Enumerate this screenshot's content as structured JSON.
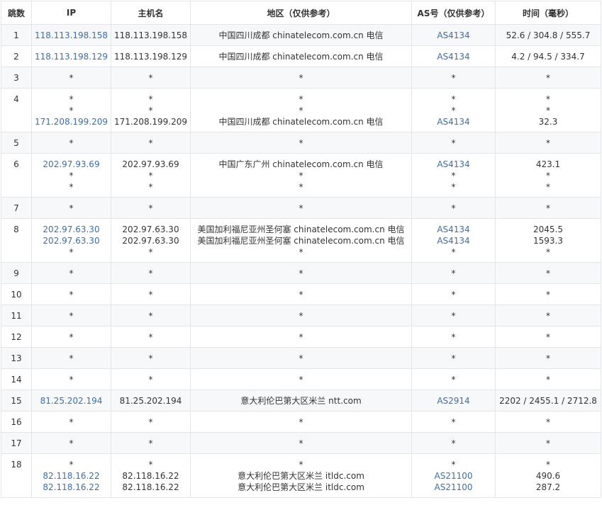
{
  "columns": {
    "hop": "跳数",
    "ip": "IP",
    "host": "主机名",
    "region": "地区（仅供参考）",
    "as": "AS号（仅供参考）",
    "time": "时间（毫秒）"
  },
  "colors": {
    "link": "#3d6ea5",
    "text": "#333333",
    "border": "#e3e5e8",
    "stripe": "#f7f8fa"
  },
  "rows": [
    {
      "hop": "1",
      "entries": [
        {
          "ip": "118.113.198.158",
          "host": "118.113.198.158",
          "region": "中国四川成都 chinatelecom.com.cn 电信",
          "as": "AS4134",
          "time": "52.6 / 304.8 / 555.7"
        }
      ]
    },
    {
      "hop": "2",
      "entries": [
        {
          "ip": "118.113.198.129",
          "host": "118.113.198.129",
          "region": "中国四川成都 chinatelecom.com.cn 电信",
          "as": "AS4134",
          "time": "4.2 / 94.5 / 334.7"
        }
      ]
    },
    {
      "hop": "3",
      "entries": [
        {
          "ip": "*",
          "host": "*",
          "region": "*",
          "as": "*",
          "time": "*"
        }
      ]
    },
    {
      "hop": "4",
      "entries": [
        {
          "ip": "*",
          "host": "*",
          "region": "*",
          "as": "*",
          "time": "*"
        },
        {
          "ip": "*",
          "host": "*",
          "region": "*",
          "as": "*",
          "time": "*"
        },
        {
          "ip": "171.208.199.209",
          "host": "171.208.199.209",
          "region": "中国四川成都 chinatelecom.com.cn 电信",
          "as": "AS4134",
          "time": "32.3"
        }
      ]
    },
    {
      "hop": "5",
      "entries": [
        {
          "ip": "*",
          "host": "*",
          "region": "*",
          "as": "*",
          "time": "*"
        }
      ]
    },
    {
      "hop": "6",
      "entries": [
        {
          "ip": "202.97.93.69",
          "host": "202.97.93.69",
          "region": "中国广东广州 chinatelecom.com.cn 电信",
          "as": "AS4134",
          "time": "423.1"
        },
        {
          "ip": "*",
          "host": "*",
          "region": "*",
          "as": "*",
          "time": "*"
        },
        {
          "ip": "*",
          "host": "*",
          "region": "*",
          "as": "*",
          "time": "*"
        }
      ]
    },
    {
      "hop": "7",
      "entries": [
        {
          "ip": "*",
          "host": "*",
          "region": "*",
          "as": "*",
          "time": "*"
        }
      ]
    },
    {
      "hop": "8",
      "entries": [
        {
          "ip": "202.97.63.30",
          "host": "202.97.63.30",
          "region": "美国加利福尼亚州圣何塞 chinatelecom.com.cn 电信",
          "as": "AS4134",
          "time": "2045.5"
        },
        {
          "ip": "202.97.63.30",
          "host": "202.97.63.30",
          "region": "美国加利福尼亚州圣何塞 chinatelecom.com.cn 电信",
          "as": "AS4134",
          "time": "1593.3"
        },
        {
          "ip": "*",
          "host": "*",
          "region": "*",
          "as": "*",
          "time": "*"
        }
      ]
    },
    {
      "hop": "9",
      "entries": [
        {
          "ip": "*",
          "host": "*",
          "region": "*",
          "as": "*",
          "time": "*"
        }
      ]
    },
    {
      "hop": "10",
      "entries": [
        {
          "ip": "*",
          "host": "*",
          "region": "*",
          "as": "*",
          "time": "*"
        }
      ]
    },
    {
      "hop": "11",
      "entries": [
        {
          "ip": "*",
          "host": "*",
          "region": "*",
          "as": "*",
          "time": "*"
        }
      ]
    },
    {
      "hop": "12",
      "entries": [
        {
          "ip": "*",
          "host": "*",
          "region": "*",
          "as": "*",
          "time": "*"
        }
      ]
    },
    {
      "hop": "13",
      "entries": [
        {
          "ip": "*",
          "host": "*",
          "region": "*",
          "as": "*",
          "time": "*"
        }
      ]
    },
    {
      "hop": "14",
      "entries": [
        {
          "ip": "*",
          "host": "*",
          "region": "*",
          "as": "*",
          "time": "*"
        }
      ]
    },
    {
      "hop": "15",
      "entries": [
        {
          "ip": "81.25.202.194",
          "host": "81.25.202.194",
          "region": "意大利伦巴第大区米兰 ntt.com",
          "as": "AS2914",
          "time": "2202 / 2455.1 / 2712.8"
        }
      ]
    },
    {
      "hop": "16",
      "entries": [
        {
          "ip": "*",
          "host": "*",
          "region": "*",
          "as": "*",
          "time": "*"
        }
      ]
    },
    {
      "hop": "17",
      "entries": [
        {
          "ip": "*",
          "host": "*",
          "region": "*",
          "as": "*",
          "time": "*"
        }
      ]
    },
    {
      "hop": "18",
      "entries": [
        {
          "ip": "*",
          "host": "*",
          "region": "*",
          "as": "*",
          "time": "*"
        },
        {
          "ip": "82.118.16.22",
          "host": "82.118.16.22",
          "region": "意大利伦巴第大区米兰 itldc.com",
          "as": "AS21100",
          "time": "490.6"
        },
        {
          "ip": "82.118.16.22",
          "host": "82.118.16.22",
          "region": "意大利伦巴第大区米兰 itldc.com",
          "as": "AS21100",
          "time": "287.2"
        }
      ]
    }
  ]
}
